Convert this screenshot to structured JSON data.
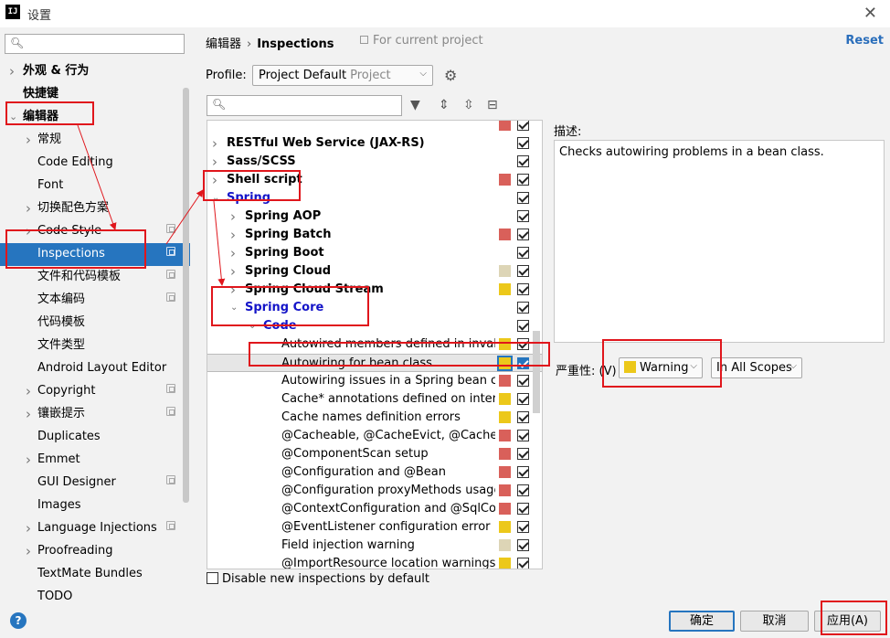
{
  "window": {
    "title": "设置",
    "app_icon": "IJ"
  },
  "sidebar": {
    "search_placeholder": "",
    "items": [
      {
        "label": "外观 & 行为",
        "indent": 0,
        "arrow": "right",
        "bold": true,
        "proj": false
      },
      {
        "label": "快捷键",
        "indent": 0,
        "arrow": "",
        "bold": true,
        "proj": false
      },
      {
        "label": "编辑器",
        "indent": 0,
        "arrow": "down",
        "bold": true,
        "proj": false
      },
      {
        "label": "常规",
        "indent": 1,
        "arrow": "right",
        "bold": false,
        "proj": false
      },
      {
        "label": "Code Editing",
        "indent": 1,
        "arrow": "",
        "bold": false,
        "proj": false
      },
      {
        "label": "Font",
        "indent": 1,
        "arrow": "",
        "bold": false,
        "proj": false
      },
      {
        "label": "切换配色方案",
        "indent": 1,
        "arrow": "right",
        "bold": false,
        "proj": false
      },
      {
        "label": "Code Style",
        "indent": 1,
        "arrow": "right",
        "bold": false,
        "proj": true
      },
      {
        "label": "Inspections",
        "indent": 1,
        "arrow": "",
        "bold": false,
        "proj": true,
        "selected": true
      },
      {
        "label": "文件和代码模板",
        "indent": 1,
        "arrow": "",
        "bold": false,
        "proj": true
      },
      {
        "label": "文本编码",
        "indent": 1,
        "arrow": "",
        "bold": false,
        "proj": true
      },
      {
        "label": "代码模板",
        "indent": 1,
        "arrow": "",
        "bold": false,
        "proj": false
      },
      {
        "label": "文件类型",
        "indent": 1,
        "arrow": "",
        "bold": false,
        "proj": false
      },
      {
        "label": "Android Layout Editor",
        "indent": 1,
        "arrow": "",
        "bold": false,
        "proj": false
      },
      {
        "label": "Copyright",
        "indent": 1,
        "arrow": "right",
        "bold": false,
        "proj": true
      },
      {
        "label": "镶嵌提示",
        "indent": 1,
        "arrow": "right",
        "bold": false,
        "proj": true
      },
      {
        "label": "Duplicates",
        "indent": 1,
        "arrow": "",
        "bold": false,
        "proj": false
      },
      {
        "label": "Emmet",
        "indent": 1,
        "arrow": "right",
        "bold": false,
        "proj": false
      },
      {
        "label": "GUI Designer",
        "indent": 1,
        "arrow": "",
        "bold": false,
        "proj": true
      },
      {
        "label": "Images",
        "indent": 1,
        "arrow": "",
        "bold": false,
        "proj": false
      },
      {
        "label": "Language Injections",
        "indent": 1,
        "arrow": "right",
        "bold": false,
        "proj": true
      },
      {
        "label": "Proofreading",
        "indent": 1,
        "arrow": "right",
        "bold": false,
        "proj": false
      },
      {
        "label": "TextMate Bundles",
        "indent": 1,
        "arrow": "",
        "bold": false,
        "proj": false
      },
      {
        "label": "TODO",
        "indent": 1,
        "arrow": "",
        "bold": false,
        "proj": false
      }
    ]
  },
  "header": {
    "crumb_parent": "编辑器",
    "crumb_separator": "›",
    "crumb_current": "Inspections",
    "for_project": "For current project",
    "reset": "Reset"
  },
  "profile": {
    "label": "Profile:",
    "value": "Project Default",
    "sub": "Project"
  },
  "tree": {
    "rows": [
      {
        "label": "",
        "level": 0,
        "arrow": "",
        "style": "normal",
        "sev": "#d9605a",
        "partial": true
      },
      {
        "label": "RESTful Web Service (JAX-RS)",
        "level": 0,
        "arrow": "right",
        "style": "bold",
        "sev": ""
      },
      {
        "label": "Sass/SCSS",
        "level": 0,
        "arrow": "right",
        "style": "bold",
        "sev": ""
      },
      {
        "label": "Shell script",
        "level": 0,
        "arrow": "right",
        "style": "bold",
        "sev": "#d9605a"
      },
      {
        "label": "Spring",
        "level": 0,
        "arrow": "down",
        "style": "blue",
        "sev": ""
      },
      {
        "label": "Spring AOP",
        "level": 1,
        "arrow": "right",
        "style": "bold",
        "sev": ""
      },
      {
        "label": "Spring Batch",
        "level": 1,
        "arrow": "right",
        "style": "bold",
        "sev": "#d9605a"
      },
      {
        "label": "Spring Boot",
        "level": 1,
        "arrow": "right",
        "style": "bold",
        "sev": ""
      },
      {
        "label": "Spring Cloud",
        "level": 1,
        "arrow": "right",
        "style": "bold",
        "sev": "#ddd5b6"
      },
      {
        "label": "Spring Cloud Stream",
        "level": 1,
        "arrow": "right",
        "style": "bold",
        "sev": "#ecc81a"
      },
      {
        "label": "Spring Core",
        "level": 1,
        "arrow": "down",
        "style": "blue",
        "sev": ""
      },
      {
        "label": "Code",
        "level": 2,
        "arrow": "down",
        "style": "blue",
        "sev": ""
      },
      {
        "label": "Autowired members defined in invalid S",
        "level": 3,
        "arrow": "",
        "style": "normal",
        "sev": "#ecc81a"
      },
      {
        "label": "Autowiring for bean class",
        "level": 3,
        "arrow": "",
        "style": "normal",
        "sev": "#ecc81a",
        "selected": true
      },
      {
        "label": "Autowiring issues in a Spring bean class",
        "level": 3,
        "arrow": "",
        "style": "normal",
        "sev": "#d9605a"
      },
      {
        "label": "Cache* annotations defined on interface",
        "level": 3,
        "arrow": "",
        "style": "normal",
        "sev": "#ecc81a"
      },
      {
        "label": "Cache names definition errors",
        "level": 3,
        "arrow": "",
        "style": "normal",
        "sev": "#ecc81a"
      },
      {
        "label": "@Cacheable, @CacheEvict, @CachePut, @",
        "level": 3,
        "arrow": "",
        "style": "normal",
        "sev": "#d9605a"
      },
      {
        "label": "@ComponentScan setup",
        "level": 3,
        "arrow": "",
        "style": "normal",
        "sev": "#d9605a"
      },
      {
        "label": "@Configuration and @Bean",
        "level": 3,
        "arrow": "",
        "style": "normal",
        "sev": "#d9605a"
      },
      {
        "label": "@Configuration proxyMethods usage w",
        "level": 3,
        "arrow": "",
        "style": "normal",
        "sev": "#d9605a"
      },
      {
        "label": "@ContextConfiguration and @SqlConfig",
        "level": 3,
        "arrow": "",
        "style": "normal",
        "sev": "#d9605a"
      },
      {
        "label": "@EventListener configuration error",
        "level": 3,
        "arrow": "",
        "style": "normal",
        "sev": "#ecc81a"
      },
      {
        "label": "Field injection warning",
        "level": 3,
        "arrow": "",
        "style": "normal",
        "sev": "#ddd5b6"
      },
      {
        "label": "@ImportResource location warnings",
        "level": 3,
        "arrow": "",
        "style": "normal",
        "sev": "#ecc81a"
      },
      {
        "label": "",
        "level": 3,
        "arrow": "",
        "style": "normal",
        "sev": "#d9605a",
        "partial": true
      }
    ]
  },
  "disable_new": "Disable new inspections by default",
  "description": {
    "label": "描述:",
    "text": "Checks autowiring problems in a bean class."
  },
  "severity": {
    "label": "严重性:",
    "mnemonic": "(V)",
    "value": "Warning",
    "color": "#ecc81a",
    "scope": "In All Scopes"
  },
  "buttons": {
    "ok": "确定",
    "cancel": "取消",
    "apply": "应用(A)"
  },
  "colors": {
    "selection": "#2675bf",
    "annotation": "#e0161c",
    "link": "#2a6ebb"
  }
}
